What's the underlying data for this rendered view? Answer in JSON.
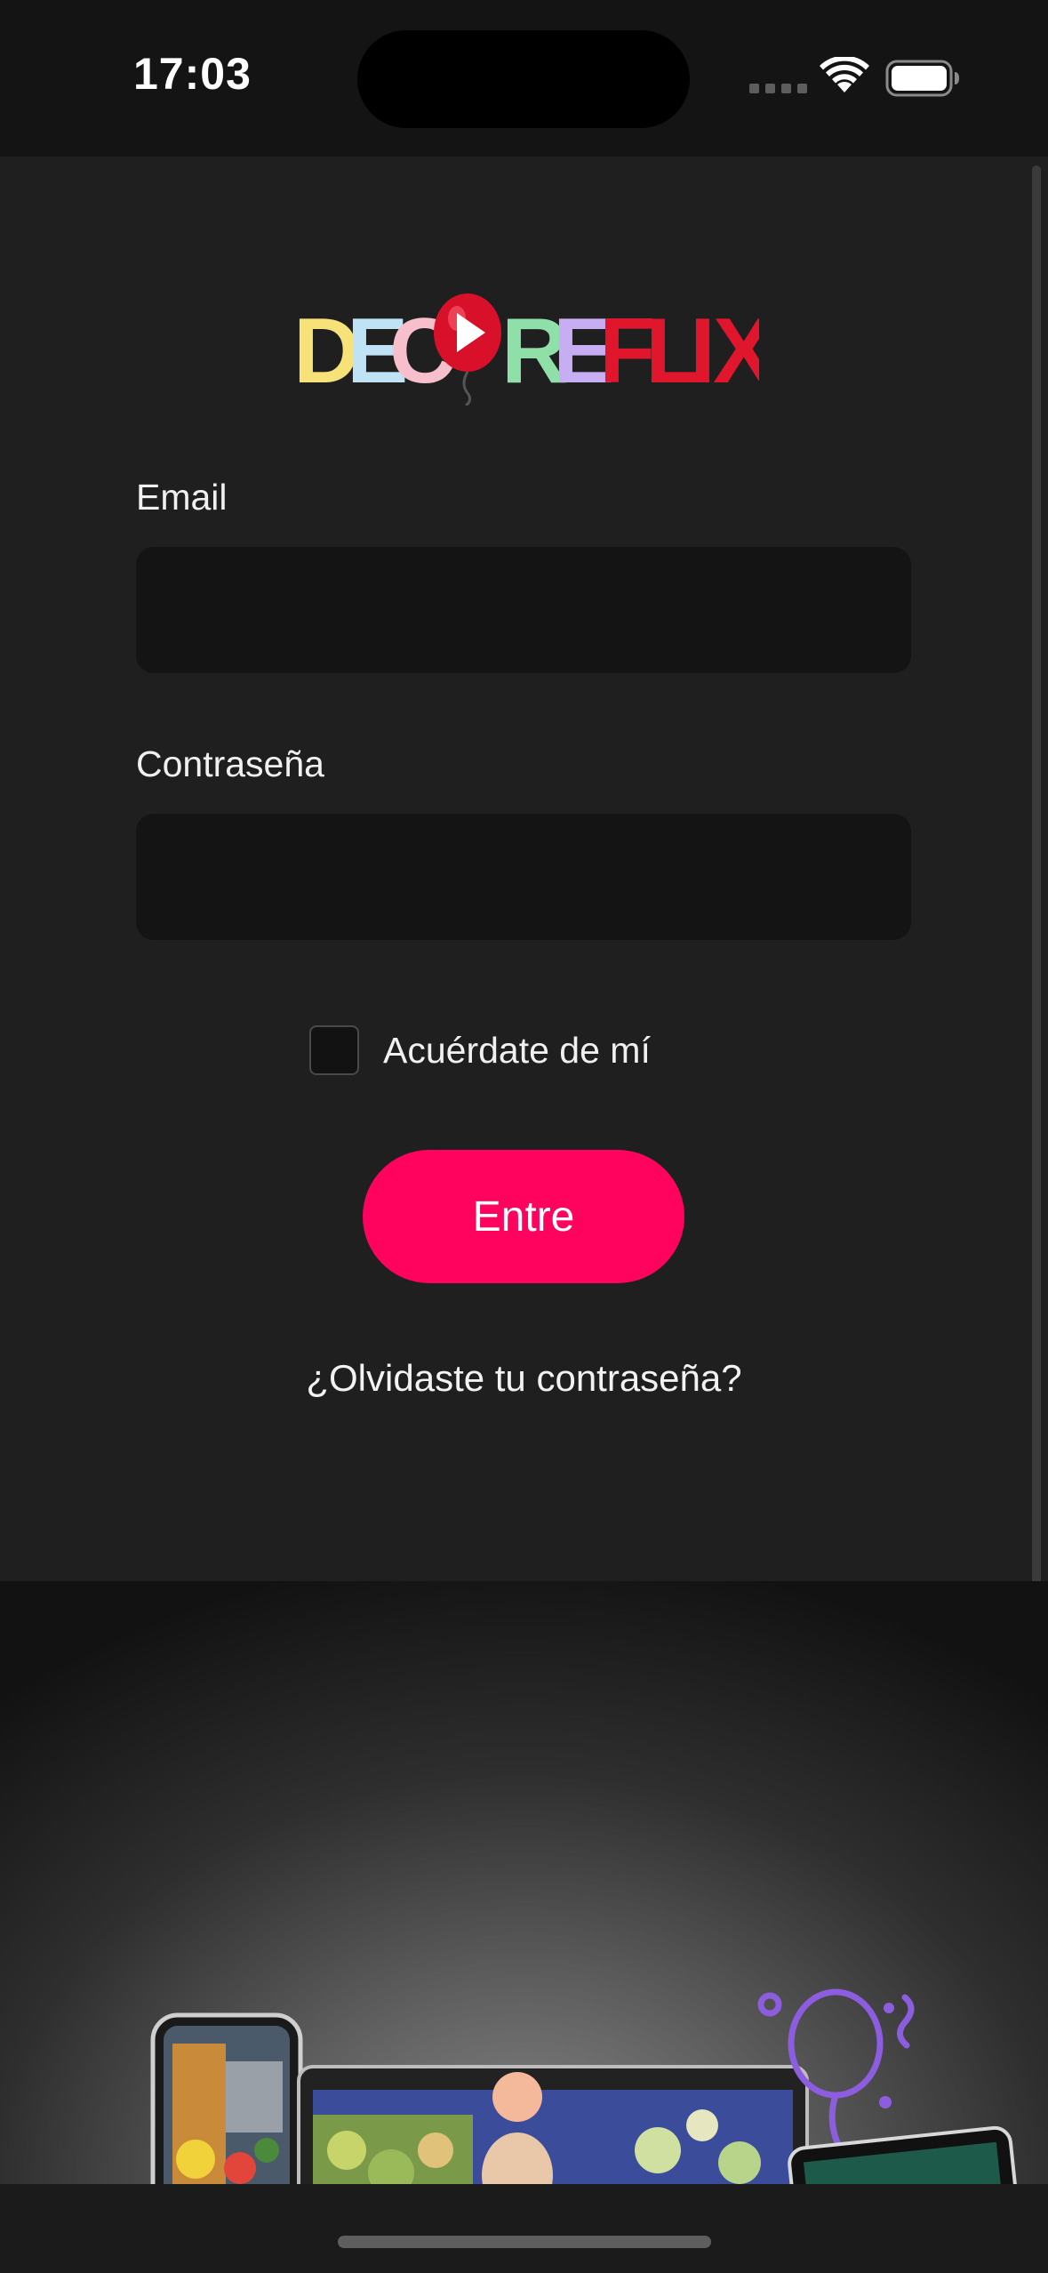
{
  "status_bar": {
    "time": "17:03"
  },
  "logo": {
    "wordmark": "DECOREFLIX",
    "letters": [
      {
        "char": "D",
        "color": "#f7e27a"
      },
      {
        "char": "E",
        "color": "#bfe3f5"
      },
      {
        "char": "C",
        "color": "#f6bfcb"
      },
      {
        "char": "O",
        "color": "#e0122b"
      },
      {
        "char": "R",
        "color": "#8fe0a8"
      },
      {
        "char": "E",
        "color": "#c7aef2"
      },
      {
        "char": "F",
        "color": "#e0162d"
      },
      {
        "char": "L",
        "color": "#e0162d"
      },
      {
        "char": "I",
        "color": "#e0162d"
      },
      {
        "char": "X",
        "color": "#e0162d"
      }
    ]
  },
  "form": {
    "email_label": "Email",
    "email_value": "",
    "password_label": "Contraseña",
    "password_value": "",
    "remember_label": "Acuérdate de mí",
    "remember_checked": false,
    "submit_label": "Entre",
    "forgot_link": "¿Olvidaste tu contraseña?"
  },
  "colors": {
    "accent": "#ff035e",
    "background": "#1f1f20",
    "input_bg": "#141414",
    "balloon": "#8d5de0"
  },
  "icons": [
    "wifi-icon",
    "battery-icon",
    "cellular-signal-icon",
    "play-icon",
    "balloon-icon",
    "checkbox-icon"
  ]
}
